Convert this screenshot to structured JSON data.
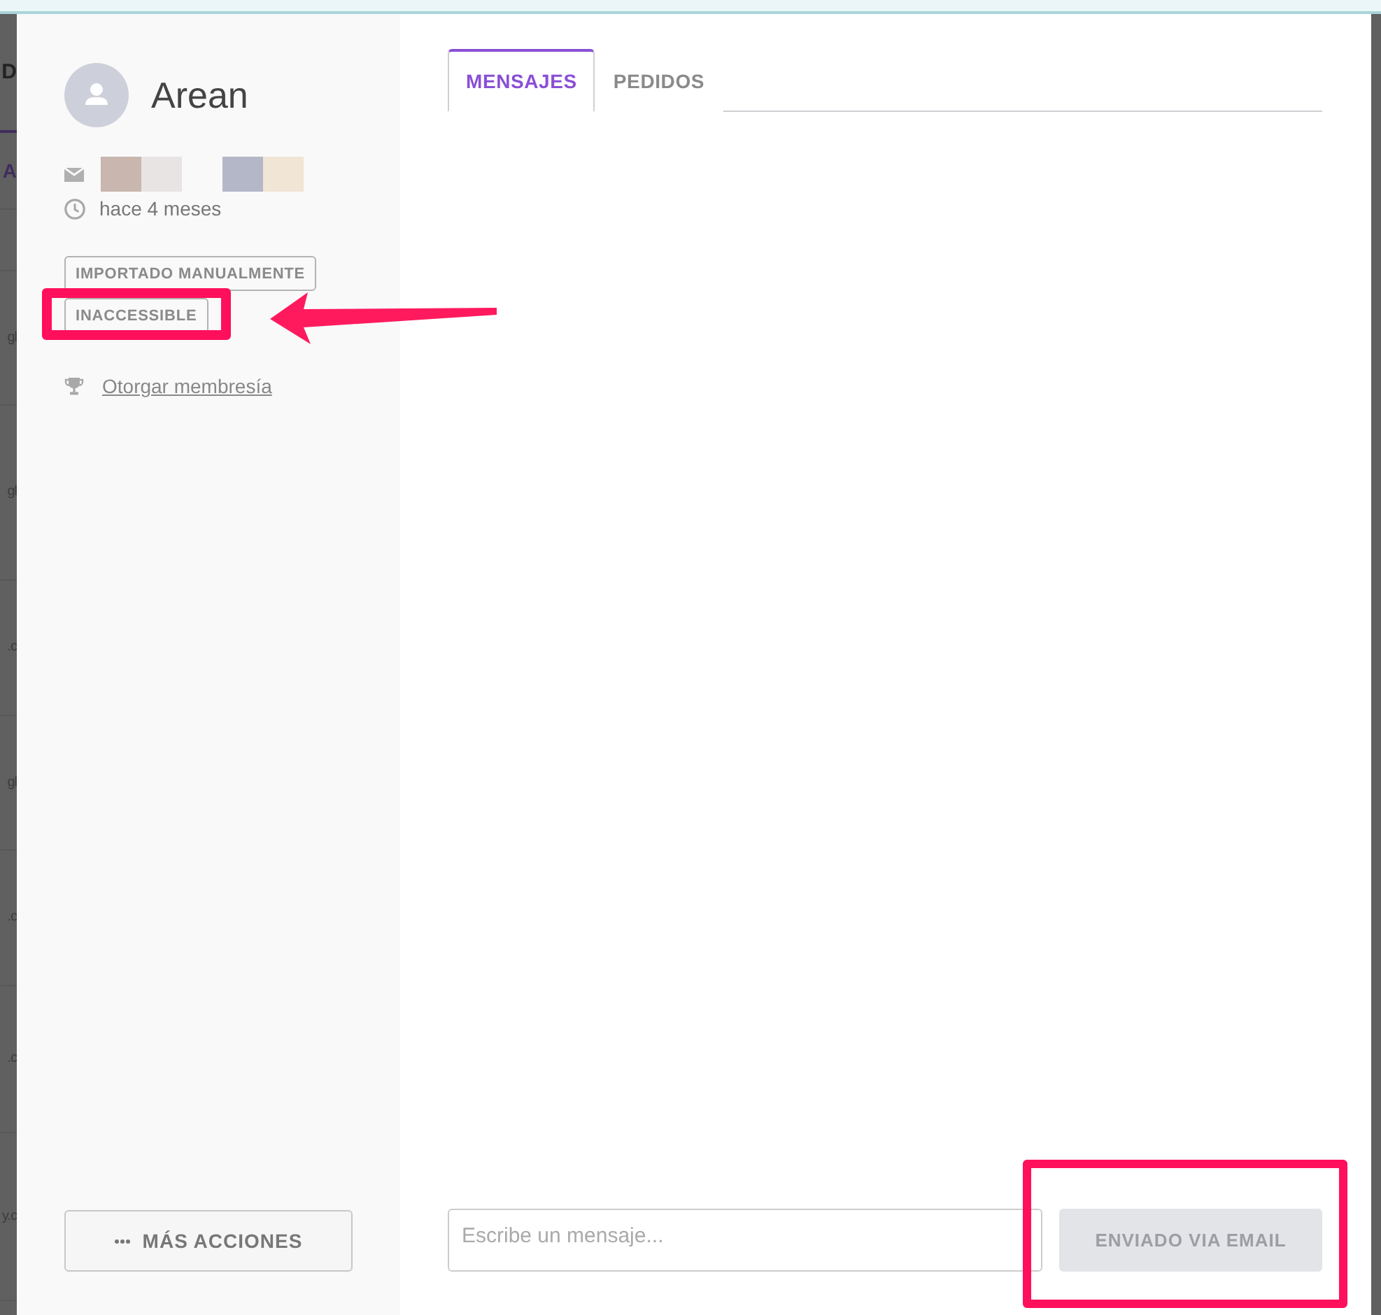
{
  "backdrop": {
    "fragments": [
      {
        "kind": "heading",
        "text": "D"
      },
      {
        "kind": "tab",
        "text": "A"
      },
      {
        "kind": "row",
        "text": "gl"
      },
      {
        "kind": "row",
        "text": "gl"
      },
      {
        "kind": "row",
        "text": ".c"
      },
      {
        "kind": "row",
        "text": "gl"
      },
      {
        "kind": "row",
        "text": ".c"
      },
      {
        "kind": "row",
        "text": ".c"
      },
      {
        "kind": "row",
        "text": "y.c"
      }
    ]
  },
  "contact": {
    "name": "Arean",
    "email_redaction": [
      {
        "blocks": [
          {
            "color": "#c9b6af"
          },
          {
            "color": "#e8e4e3"
          }
        ]
      },
      {
        "blocks": [
          {
            "color": "#b3b7c8"
          },
          {
            "color": "#f1e5d6"
          }
        ]
      }
    ],
    "last_seen": "hace 4 meses",
    "tags": [
      {
        "label": "IMPORTADO MANUALMENTE",
        "highlighted": false,
        "arrow": false
      },
      {
        "label": "INACCESSIBLE",
        "highlighted": true,
        "arrow": true
      }
    ],
    "grant_link": "Otorgar membresía"
  },
  "more_actions": {
    "label": "MÁS ACCIONES"
  },
  "tabs": [
    {
      "label": "MENSAJES",
      "selected": true
    },
    {
      "label": "PEDIDOS",
      "selected": false
    }
  ],
  "composer": {
    "placeholder": "Escribe un mensaje...",
    "send_button": {
      "label": "ENVIADO VIA EMAIL",
      "disabled": true,
      "highlighted": true
    }
  }
}
